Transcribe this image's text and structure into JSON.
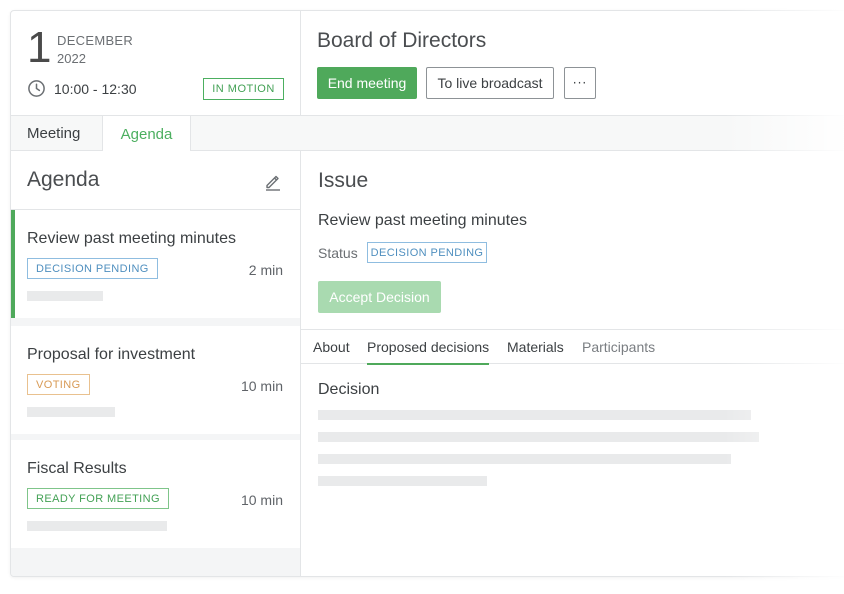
{
  "date": {
    "day": "1",
    "month": "DECEMBER",
    "year": "2022",
    "time": "10:00 - 12:30",
    "status": "IN MOTION"
  },
  "header": {
    "title": "Board of Directors",
    "end_meeting": "End meeting",
    "live_broadcast": "To live broadcast",
    "more": "···"
  },
  "tabs": {
    "meeting": "Meeting",
    "agenda": "Agenda"
  },
  "agenda": {
    "title": "Agenda",
    "items": [
      {
        "title": "Review past meeting minutes",
        "status": "DECISION PENDING",
        "duration": "2 min"
      },
      {
        "title": "Proposal for investment",
        "status": "VOTING",
        "duration": "10 min"
      },
      {
        "title": "Fiscal Results",
        "status": "READY FOR MEETING",
        "duration": "10 min"
      }
    ]
  },
  "issue": {
    "title": "Issue",
    "name": "Review past meeting minutes",
    "status_label": "Status",
    "status": "DECISION PENDING",
    "accept_button": "Accept Decision",
    "tabs": [
      "About",
      "Proposed decisions",
      "Materials",
      "Participants"
    ],
    "active_tab": "Proposed decisions",
    "decision_title": "Decision"
  },
  "colors": {
    "accent_green": "#4fa95b",
    "status_blue": "#4f8fbf",
    "status_orange": "#d89a55",
    "status_green": "#43a155"
  },
  "icons": {
    "clock": "clock-icon",
    "edit": "pencil-icon",
    "more": "ellipsis-icon"
  }
}
